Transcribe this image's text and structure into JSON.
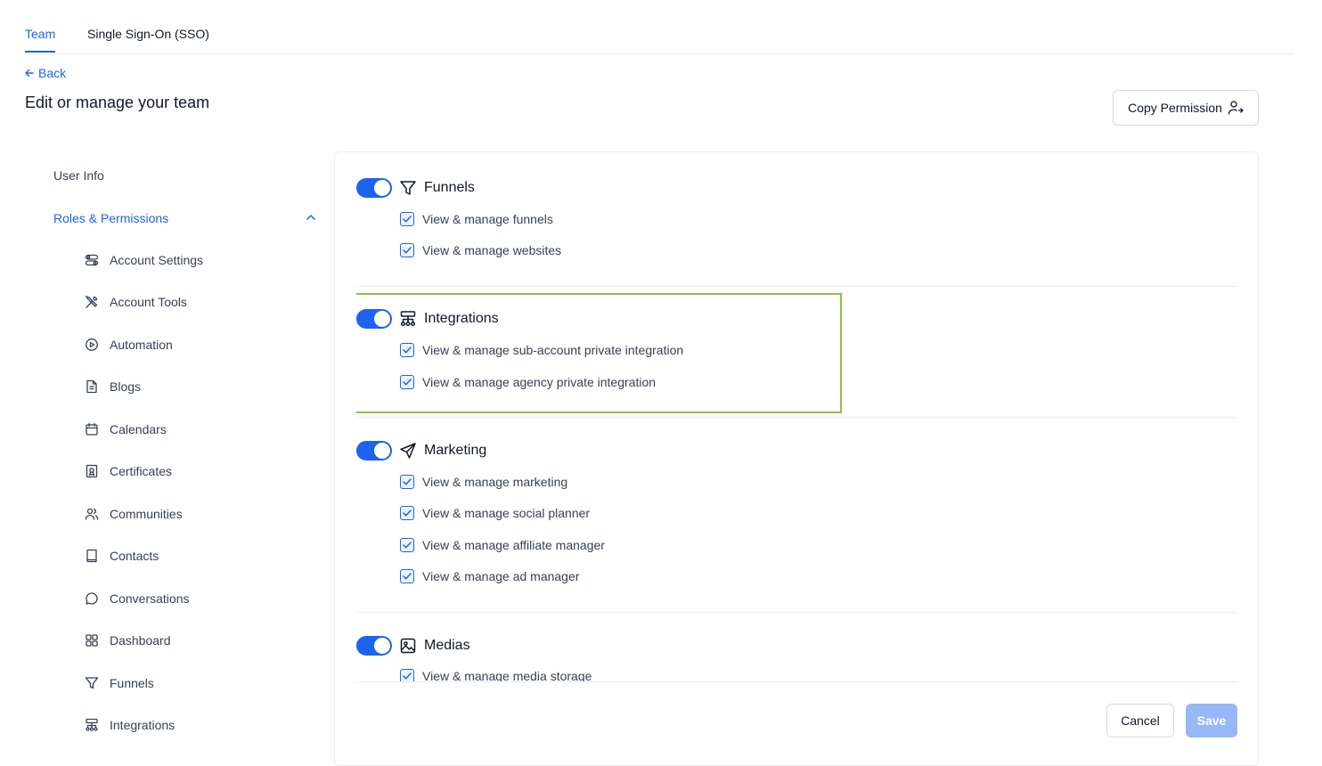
{
  "tabs": [
    {
      "label": "Team",
      "active": true
    },
    {
      "label": "Single Sign-On (SSO)",
      "active": false
    }
  ],
  "back_label": "Back",
  "page_title": "Edit or manage your team",
  "copy_permission_label": "Copy Permission",
  "sidebar": {
    "user_info": "User Info",
    "roles_permissions": "Roles & Permissions",
    "items": [
      {
        "label": "Account Settings",
        "icon": "settings-toggles-icon"
      },
      {
        "label": "Account Tools",
        "icon": "tools-icon"
      },
      {
        "label": "Automation",
        "icon": "play-circle-icon"
      },
      {
        "label": "Blogs",
        "icon": "document-icon"
      },
      {
        "label": "Calendars",
        "icon": "calendar-icon"
      },
      {
        "label": "Certificates",
        "icon": "certificate-icon"
      },
      {
        "label": "Communities",
        "icon": "users-icon"
      },
      {
        "label": "Contacts",
        "icon": "book-icon"
      },
      {
        "label": "Conversations",
        "icon": "chat-icon"
      },
      {
        "label": "Dashboard",
        "icon": "grid-icon"
      },
      {
        "label": "Funnels",
        "icon": "funnel-icon"
      },
      {
        "label": "Integrations",
        "icon": "integrations-icon"
      }
    ]
  },
  "sections": [
    {
      "title": "Funnels",
      "icon": "funnel-icon",
      "enabled": true,
      "permissions": [
        "View & manage funnels",
        "View & manage websites"
      ]
    },
    {
      "title": "Integrations",
      "icon": "integrations-icon",
      "enabled": true,
      "permissions": [
        "View & manage sub-account private integration",
        "View & manage agency private integration"
      ]
    },
    {
      "title": "Marketing",
      "icon": "send-icon",
      "enabled": true,
      "permissions": [
        "View & manage marketing",
        "View & manage social planner",
        "View & manage affiliate manager",
        "View & manage ad manager"
      ]
    },
    {
      "title": "Medias",
      "icon": "image-icon",
      "enabled": true,
      "permissions": [
        "View & manage media storage"
      ]
    }
  ],
  "footer": {
    "cancel_label": "Cancel",
    "save_label": "Save"
  },
  "colors": {
    "primary": "#1d63ed",
    "highlight": "#8bc34a",
    "save_disabled": "#97b8f7"
  }
}
